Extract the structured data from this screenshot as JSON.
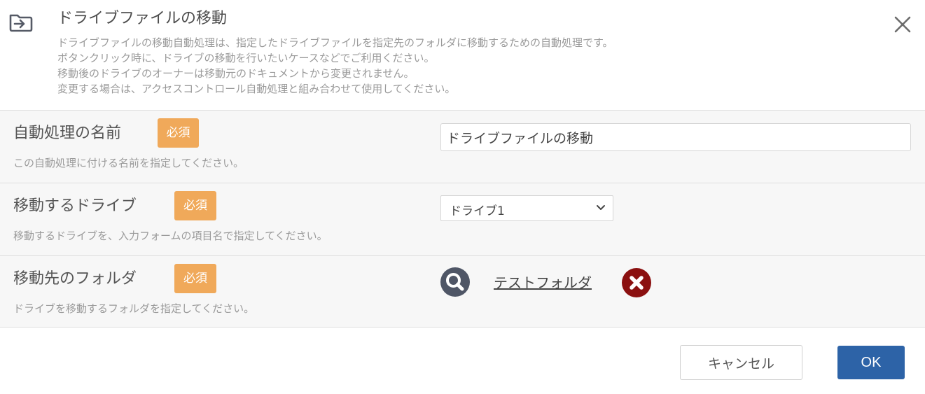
{
  "dialog": {
    "title": "ドライブファイルの移動",
    "description": [
      "ドライブファイルの移動自動処理は、指定したドライブファイルを指定先のフォルダに移動するための自動処理です。",
      "ボタンクリック時に、ドライブの移動を行いたいケースなどでご利用ください。",
      "移動後のドライブのオーナーは移動元のドキュメントから変更されません。",
      "変更する場合は、アクセスコントロール自動処理と組み合わせて使用してください。"
    ],
    "header_icon": "folder-move-icon",
    "close_icon": "close-icon"
  },
  "fields": {
    "name": {
      "label": "自動処理の名前",
      "required_badge": "必須",
      "help": "この自動処理に付ける名前を指定してください。",
      "value": "ドライブファイルの移動"
    },
    "drive": {
      "label": "移動するドライブ",
      "required_badge": "必須",
      "help": "移動するドライブを、入力フォームの項目名で指定してください。",
      "selected": "ドライブ1"
    },
    "folder": {
      "label": "移動先のフォルダ",
      "required_badge": "必須",
      "help": "ドライブを移動するフォルダを指定してください。",
      "folder_name": "テストフォルダ",
      "search_icon": "search-icon",
      "remove_icon": "remove-icon"
    }
  },
  "footer": {
    "cancel_label": "キャンセル",
    "ok_label": "OK"
  },
  "colors": {
    "required_badge": "#f0a95a",
    "ok_button": "#2d63a7",
    "search_icon": "#4f5666",
    "remove_icon": "#8b1010",
    "row_background": "#f7f7f7"
  }
}
